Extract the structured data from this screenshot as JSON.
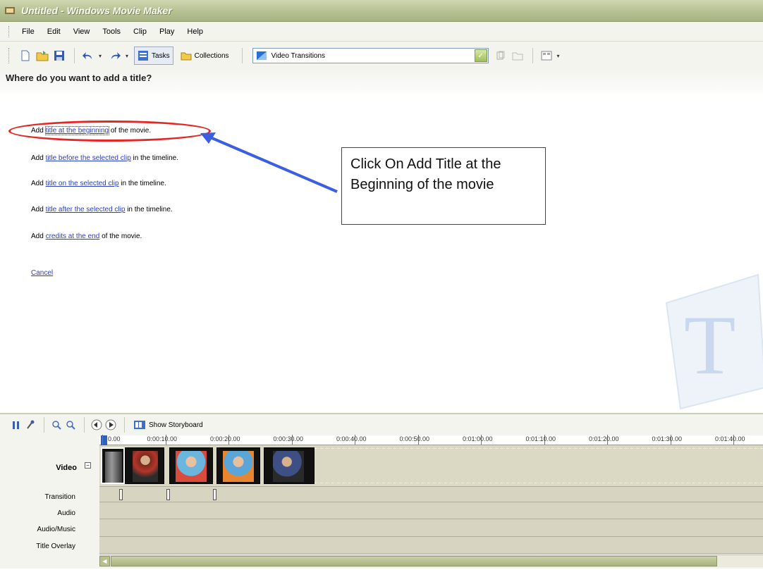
{
  "window": {
    "title": "Untitled - Windows Movie Maker"
  },
  "menu": [
    "File",
    "Edit",
    "View",
    "Tools",
    "Clip",
    "Play",
    "Help"
  ],
  "toolbar": {
    "tasks_label": "Tasks",
    "collections_label": "Collections",
    "collection_select": "Video Transitions"
  },
  "task_pane": {
    "heading": "Where do you want to add a title?",
    "options": [
      {
        "prefix": "Add ",
        "link": "title at the beginning",
        "suffix": " of the movie."
      },
      {
        "prefix": "Add ",
        "link": "title before the selected clip",
        "suffix": " in the timeline."
      },
      {
        "prefix": "Add ",
        "link": "title on the selected clip",
        "suffix": " in the timeline."
      },
      {
        "prefix": "Add ",
        "link": "title after the selected clip",
        "suffix": " in the timeline."
      },
      {
        "prefix": "Add ",
        "link": "credits at the end",
        "suffix": " of the movie."
      }
    ],
    "cancel_label": "Cancel"
  },
  "annotation": {
    "callout_text": "Click On Add Title at the Beginning of the movie",
    "highlight_color": "#e52626",
    "arrow_color": "#3a5fe0"
  },
  "timeline": {
    "show_storyboard_label": "Show Storyboard",
    "ruler_ticks": [
      "0.00",
      "0:00:10.00",
      "0:00:20.00",
      "0:00:30.00",
      "0:00:40.00",
      "0:00:50.00",
      "0:01:00.00",
      "0:01:10.00",
      "0:01:20.00",
      "0:01:30.00",
      "0:01:40.00"
    ],
    "tracks": {
      "video": "Video",
      "transition": "Transition",
      "audio": "Audio",
      "audio_music": "Audio/Music",
      "title_overlay": "Title Overlay"
    },
    "clip_count": 5
  }
}
